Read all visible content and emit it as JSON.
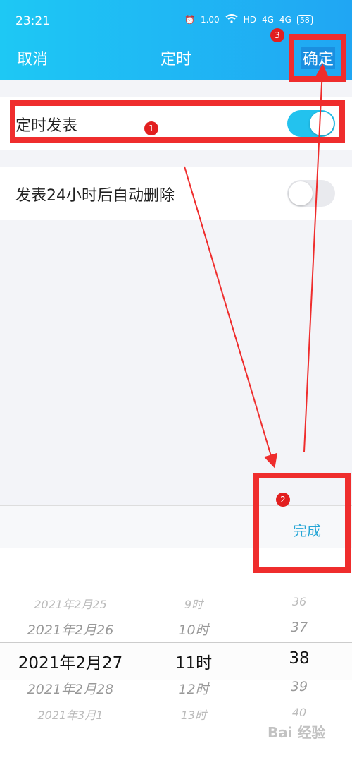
{
  "status_bar": {
    "time": "23:21",
    "net_speed": "1.00",
    "hd": "HD",
    "signal1": "4G",
    "signal2": "4G",
    "battery": "58"
  },
  "nav": {
    "cancel": "取消",
    "title": "定时",
    "confirm": "确定"
  },
  "settings": [
    {
      "label": "定时发表",
      "on": true
    },
    {
      "label": "发表24小时后自动删除",
      "on": false
    }
  ],
  "picker": {
    "done_label": "完成",
    "dates": [
      "2021年2月25",
      "2021年2月26",
      "2021年2月27",
      "2021年2月28",
      "2021年3月1"
    ],
    "hours": [
      "9时",
      "10时",
      "11时",
      "12时",
      "13时"
    ],
    "minutes": [
      "36",
      "37",
      "38",
      "39",
      "40"
    ],
    "selected_index": 2
  },
  "annotations": {
    "badge1": "1",
    "badge2": "2",
    "badge3": "3",
    "annotation_color": "#ef2d2d"
  },
  "watermark": "Bai 经验",
  "colors": {
    "header_start": "#1ec8f4",
    "header_end": "#20a6f3",
    "toggle_on": "#23c2ee",
    "accent": "#26a6d6"
  }
}
